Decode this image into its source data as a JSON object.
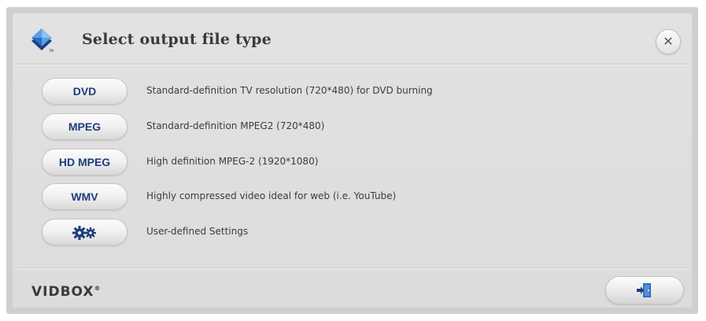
{
  "dialog": {
    "title": "Select output file type",
    "close_icon": "close-icon",
    "logo_icon": "vidbox-logo-icon"
  },
  "options": [
    {
      "label": "DVD",
      "description": "Standard-definition TV resolution (720*480) for DVD burning"
    },
    {
      "label": "MPEG",
      "description": "Standard-definition MPEG2 (720*480)"
    },
    {
      "label": "HD MPEG",
      "description": "High definition MPEG-2 (1920*1080)"
    },
    {
      "label": "WMV",
      "description": "Highly compressed video ideal for web (i.e. YouTube)"
    },
    {
      "label": "",
      "icon": "gears-icon",
      "description": "User-defined Settings"
    }
  ],
  "footer": {
    "brand": "VIDBOX",
    "brand_mark": "®",
    "exit_icon": "exit-door-icon"
  },
  "colors": {
    "button_text": "#1f3d7c",
    "logo_blue": "#2b6cc4"
  }
}
